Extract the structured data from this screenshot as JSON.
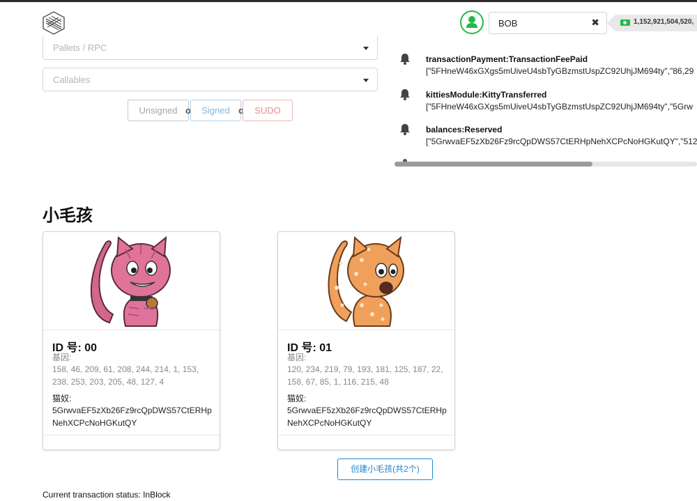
{
  "header": {
    "account_value": "BOB",
    "clear_icon": "close-icon",
    "balance": "1,152,921,504,520,"
  },
  "extrinsic": {
    "pallets_placeholder": "Pallets / RPC",
    "callables_placeholder": "Callables",
    "buttons": {
      "unsigned": "Unsigned",
      "signed": "Signed",
      "sudo": "SUDO",
      "or": "or"
    }
  },
  "events": [
    {
      "name": "transactionPayment:TransactionFeePaid",
      "data": "[\"5FHneW46xGXgs5mUiveU4sbTyGBzmstUspZC92UhjJM694ty\",\"86,29"
    },
    {
      "name": "kittiesModule:KittyTransferred",
      "data": "[\"5FHneW46xGXgs5mUiveU4sbTyGBzmstUspZC92UhjJM694ty\",\"5Grw"
    },
    {
      "name": "balances:Reserved",
      "data": "[\"5GrwvaEF5zXb26Fz9rcQpDWS57CtERHpNehXCPcNoHGKutQY\",\"512"
    }
  ],
  "kitties": {
    "title": "小毛孩",
    "cards": [
      {
        "id_label": "ID 号: 00",
        "dna_label": "基因:",
        "dna": "158, 46, 209, 61, 208, 244, 214, 1, 153, 238, 253, 203, 205, 48, 127, 4",
        "owner_label": "猫奴:",
        "owner": "5GrwvaEF5zXb26Fz9rcQpDWS57CtERHpNehXCPcNoHGKutQY",
        "color": "#e0739a"
      },
      {
        "id_label": "ID 号: 01",
        "dna_label": "基因:",
        "dna": "120, 234, 219, 79, 193, 181, 125, 187, 22, 158, 67, 85, 1, 116, 215, 48",
        "owner_label": "猫奴:",
        "owner": "5GrwvaEF5zXb26Fz9rcQpDWS57CtERHpNehXCPcNoHGKutQY",
        "color": "#f0a05a"
      }
    ],
    "create_button": "创建小毛孩(共2个)"
  },
  "status": "Current transaction status: InBlock"
}
